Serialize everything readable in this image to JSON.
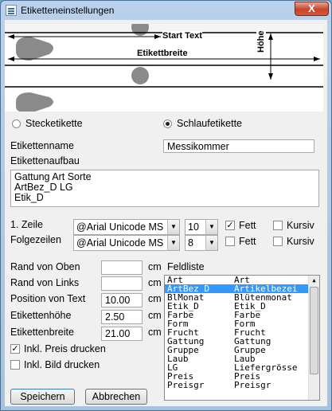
{
  "window": {
    "title": "Etiketteneinstellungen",
    "close_glyph": "X"
  },
  "preview": {
    "start_text": "Start Text",
    "width_label": "Etikettbreite",
    "height_label": "Höhe"
  },
  "label_type": {
    "option1": "Stecketikette",
    "option2": "Schlaufetikette",
    "selected": "Schlaufetikette"
  },
  "name": {
    "label": "Etikettenname",
    "value": "Messikommer"
  },
  "layout": {
    "label": "Etikettenaufbau",
    "lines": [
      "Gattung  Art Sorte",
      "ArtBez_D LG",
      "Etik_D"
    ]
  },
  "line1": {
    "label": "1. Zeile",
    "font": "@Arial Unicode MS",
    "size": "10",
    "bold_label": "Fett",
    "bold": true,
    "italic_label": "Kursiv",
    "italic": false
  },
  "following": {
    "label": "Folgezeilen",
    "font": "@Arial Unicode MS",
    "size": "8",
    "bold_label": "Fett",
    "bold": false,
    "italic_label": "Kursiv",
    "italic": false
  },
  "margins": {
    "top": {
      "label": "Rand von Oben",
      "value": "",
      "unit": "cm"
    },
    "left": {
      "label": "Rand von Links",
      "value": "",
      "unit": "cm"
    },
    "text_pos": {
      "label": "Position von Text",
      "value": "10.00",
      "unit": "cm"
    },
    "height": {
      "label": "Etikettenhöhe",
      "value": "2.50",
      "unit": "cm"
    },
    "width": {
      "label": "Etikettenbreite",
      "value": "21.00",
      "unit": "cm"
    }
  },
  "print_price": {
    "label": "Inkl. Preis drucken",
    "checked": true
  },
  "print_image": {
    "label": "Inkl. Bild drucken",
    "checked": false
  },
  "fieldlist": {
    "label": "Feldliste",
    "selected_index": 1,
    "rows": [
      [
        "Art",
        "Art"
      ],
      [
        "ArtBez_D",
        "Artikelbezei"
      ],
      [
        "BlMonat",
        "Blütenmonat"
      ],
      [
        "Etik_D",
        "Etik_D"
      ],
      [
        "Farbe",
        "Farbe"
      ],
      [
        "Form",
        "Form"
      ],
      [
        "Frucht",
        "Frucht"
      ],
      [
        "Gattung",
        "Gattung"
      ],
      [
        "Gruppe",
        "Gruppe"
      ],
      [
        "Laub",
        "Laub"
      ],
      [
        "LG",
        "Liefergrösse"
      ],
      [
        "Preis",
        "Preis"
      ],
      [
        "Preisgr",
        "Preisgr"
      ]
    ]
  },
  "buttons": {
    "save": "Speichern",
    "cancel": "Abbrechen"
  },
  "colors": {
    "selection": "#3399ff",
    "window_frame": "#a7c2df",
    "close_button": "#c7442c"
  }
}
